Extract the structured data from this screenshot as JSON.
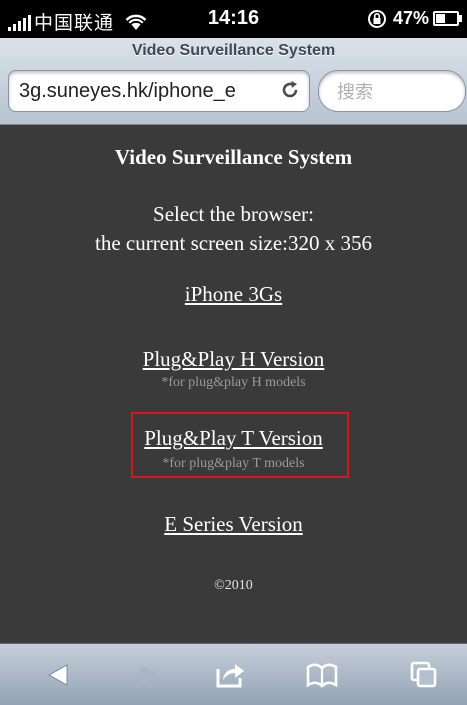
{
  "status_bar": {
    "carrier": "中国联通",
    "time": "14:16",
    "battery_percent": "47%",
    "battery_level": 0.47,
    "icons": [
      "signal-icon",
      "wifi-icon",
      "rotation-lock-icon",
      "battery-icon"
    ]
  },
  "browser": {
    "page_title": "Video Surveillance System",
    "url": "3g.suneyes.hk/iphone_e",
    "search_placeholder": "搜索"
  },
  "content": {
    "title": "Video Surveillance System",
    "select_text": "Select the browser:",
    "screen_size_text": "the current screen size:320 x 356",
    "links": {
      "iphone": "iPhone 3Gs",
      "plug_h": "Plug&Play H Version ",
      "plug_h_sub": "*for plug&play H models",
      "plug_t": "Plug&Play T Version ",
      "plug_t_sub": "*for plug&play T models",
      "e_series": "E Series Version"
    },
    "copyright": "©2010"
  },
  "toolbar": {
    "icons": [
      "back-icon",
      "forward-icon",
      "share-icon",
      "bookmarks-icon",
      "tabs-icon"
    ]
  },
  "colors": {
    "background": "#3a3a3a",
    "highlight": "#d9161b"
  }
}
